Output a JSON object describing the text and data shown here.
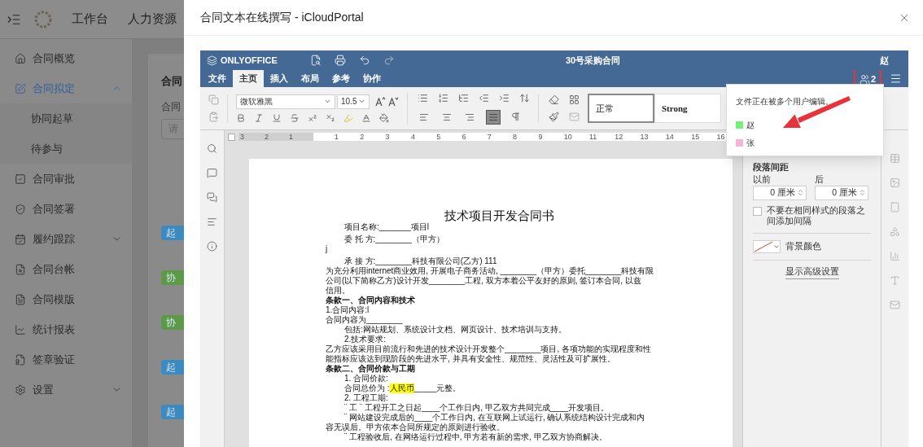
{
  "app": {
    "nav": [
      "工作台",
      "人力资源"
    ],
    "sidebar": [
      {
        "label": "合同概览",
        "selected": false
      },
      {
        "label": "合同拟定",
        "selected": true,
        "expanded": true,
        "children": [
          {
            "label": "协同起草",
            "selected": false
          },
          {
            "label": "待参与",
            "selected": false
          }
        ]
      },
      {
        "label": "合同审批",
        "selected": false
      },
      {
        "label": "合同签署",
        "selected": false
      },
      {
        "label": "履约跟踪",
        "selected": false,
        "expanded": false
      },
      {
        "label": "合同台帐",
        "selected": false
      },
      {
        "label": "合同模版",
        "selected": false
      },
      {
        "label": "统计报表",
        "selected": false
      },
      {
        "label": "签章验证",
        "selected": false
      },
      {
        "label": "设置",
        "selected": false,
        "expanded": false
      }
    ],
    "page_title": "合同",
    "filter_label": "合同",
    "search": {
      "placeholder": "请"
    },
    "tags": [
      {
        "label": "起",
        "color": "#3d8ac0"
      },
      {
        "label": "协",
        "color": "#5c9a48"
      },
      {
        "label": "协",
        "color": "#5c9a48"
      },
      {
        "label": "起",
        "color": "#3d8ac0"
      },
      {
        "label": "起",
        "color": "#3d8ac0"
      }
    ]
  },
  "modal": {
    "title": "合同文本在线撰写 - iCloudPortal"
  },
  "editor": {
    "brand": "ONLYOFFICE",
    "document_title": "30号采购合同",
    "current_user": "赵",
    "tabs": [
      {
        "label": "文件",
        "selected": false
      },
      {
        "label": "主页",
        "selected": true
      },
      {
        "label": "插入",
        "selected": false
      },
      {
        "label": "布局",
        "selected": false
      },
      {
        "label": "参考",
        "selected": false
      },
      {
        "label": "协作",
        "selected": false
      }
    ],
    "font": "微软雅黑",
    "font_size": "10.5",
    "alignments": [
      {
        "kind": "left",
        "selected": false
      },
      {
        "kind": "center",
        "selected": false
      },
      {
        "kind": "right",
        "selected": false
      },
      {
        "kind": "justify",
        "selected": true
      }
    ],
    "styles": [
      {
        "label": "正常",
        "selected": true
      },
      {
        "label": "Strong",
        "selected": false
      }
    ],
    "ruler": {
      "before": [
        "3",
        "2",
        "1"
      ],
      "after": [
        "1",
        "2",
        "3",
        "4",
        "5",
        "6",
        "7",
        "8",
        "9",
        "10",
        "11",
        "12",
        "13",
        "14",
        "15",
        "16"
      ]
    },
    "co_editing": {
      "users_count": "2",
      "message": "文件正在被多个用户编辑。",
      "users": [
        {
          "name": "赵",
          "color": "#77ee77"
        },
        {
          "name": "张",
          "color": "#f5b5d5"
        }
      ]
    },
    "paragraph_panel": {
      "spacing_label": "段落间距",
      "before_label": "以前",
      "after_label": "后",
      "before": "0 厘米",
      "after": "0 厘米",
      "no_space_same_style": {
        "label": "不要在相同样式的段落之间添加间隔",
        "checked": false
      },
      "background_label": "背景颜色",
      "advanced_link": "显示高级设置"
    },
    "document": [
      {
        "kind": "title",
        "text": "技术项目开发合同书"
      },
      {
        "kind": "indent",
        "text": "项目名称:_______项目l"
      },
      {
        "kind": "gap"
      },
      {
        "kind": "indent",
        "text": "委 托 方:________（甲方）"
      },
      {
        "kind": "plain",
        "text": "j"
      },
      {
        "kind": "gap"
      },
      {
        "kind": "indent",
        "text": "承 接 方:________科技有限公司(乙方)   111"
      },
      {
        "kind": "plain",
        "text": "为充分利用internet商业效用, 开展电子商务活动, ________（甲方）委托________科技有限"
      },
      {
        "kind": "plain",
        "text": "公司(以下简称乙方)设计开发________工程,   双方本着公平友好的原则, 签订本合同, 以兹"
      },
      {
        "kind": "plain",
        "text": "信用。"
      },
      {
        "kind": "bold",
        "text": "条款一、合同内容和技术"
      },
      {
        "kind": "plain",
        "text": "1.合同内容:l"
      },
      {
        "kind": "plain",
        "text": "合同内容为________"
      },
      {
        "kind": "indent",
        "text": "包括:网站规划、系统设计文档、网页设计、技术培训与支持。"
      },
      {
        "kind": "indent",
        "text": "2.技术要求:"
      },
      {
        "kind": "plain",
        "text": "乙方应该采用目前流行和先进的技术设计开发整个________项目, 各项功能的实现程度和性"
      },
      {
        "kind": "plain",
        "text": "能指标应该达到现阶段的先进水平, 并具有安全性、规范性、灵活性及可扩展性。"
      },
      {
        "kind": "bold",
        "text": "条款二、合同价款与工期"
      },
      {
        "kind": "indent",
        "text": "1. 合同价款:"
      },
      {
        "kind": "price",
        "prefix": "合同总价为 :",
        "highlight": "人民币",
        "suffix": "_____元整。"
      },
      {
        "kind": "indent",
        "text": "2. 工程工期:"
      },
      {
        "kind": "indent",
        "text": "¨ 工 ¨ 工程开工之日起____个工作日内, 甲乙双方共同完成____开发项目。"
      },
      {
        "kind": "indent",
        "text": "¨ 网站建设完成后的____个工作日内, 在互联网上试运行, 确认系统结构设计完成和内"
      },
      {
        "kind": "plain",
        "text": "容无误后。甲方依本合同所规定的原则进行验收。"
      },
      {
        "kind": "indent",
        "text": "¨ 工程验收后, 在网络运行过程中, 甲方若有新的需求, 甲乙双方协商解决。"
      }
    ]
  }
}
